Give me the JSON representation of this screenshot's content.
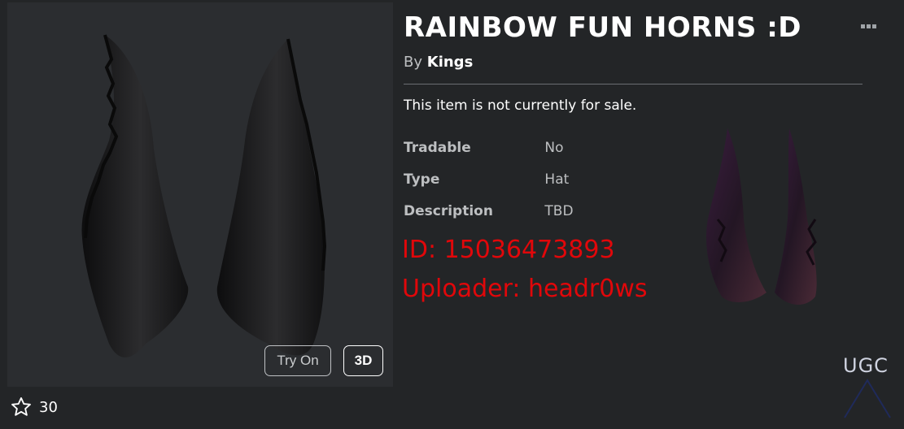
{
  "item": {
    "title": "RAINBOW FUN HORNS :D",
    "by_prefix": "By",
    "creator": "Kings",
    "sale_status": "This item is not currently for sale.",
    "details": [
      {
        "label": "Tradable",
        "value": "No"
      },
      {
        "label": "Type",
        "value": "Hat"
      },
      {
        "label": "Description",
        "value": "TBD"
      }
    ]
  },
  "preview": {
    "try_on_label": "Try On",
    "three_d_label": "3D"
  },
  "overlay": {
    "id_text": "ID: 15036473893",
    "uploader_text": "Uploader: headr0ws",
    "color": "#e1070a"
  },
  "badge": {
    "ugc_label": "UGC"
  },
  "favorites": {
    "count": "30"
  },
  "icons": {
    "more": "more-options-icon",
    "favorite": "star-outline-icon"
  },
  "colors": {
    "background": "#232527",
    "preview_bg": "#2b2d30",
    "text_secondary": "#bdbfc1"
  }
}
